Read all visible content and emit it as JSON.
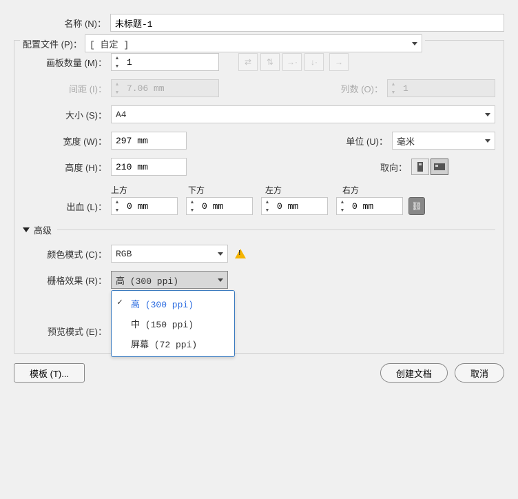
{
  "name": {
    "label": "名称 (N)：",
    "value": "未标题-1"
  },
  "profile": {
    "label": "配置文件 (P)：",
    "value": "[ 自定 ]"
  },
  "artboards": {
    "count_label": "画板数量 (M)：",
    "count_value": "1",
    "spacing_label": "间距 (I)：",
    "spacing_value": "7.06 mm",
    "cols_label": "列数 (O)：",
    "cols_value": "1"
  },
  "size": {
    "label": "大小 (S)：",
    "value": "A4"
  },
  "width": {
    "label": "宽度 (W)：",
    "value": "297 mm"
  },
  "height": {
    "label": "高度 (H)：",
    "value": "210 mm"
  },
  "units": {
    "label": "单位 (U)：",
    "value": "毫米"
  },
  "orient": {
    "label": "取向："
  },
  "bleed": {
    "label": "出血 (L)：",
    "top_h": "上方",
    "bottom_h": "下方",
    "left_h": "左方",
    "right_h": "右方",
    "top": "0 mm",
    "bottom": "0 mm",
    "left": "0 mm",
    "right": "0 mm"
  },
  "advanced_label": "高级",
  "color_mode": {
    "label": "颜色模式 (C)：",
    "value": "RGB"
  },
  "raster": {
    "label": "栅格效果 (R)：",
    "value": "高 (300 ppi)",
    "options": [
      "高 (300 ppi)",
      "中 (150 ppi)",
      "屏幕 (72 ppi)"
    ],
    "selected_index": 0
  },
  "preview": {
    "label": "预览模式 (E)："
  },
  "buttons": {
    "template": "模板 (T)...",
    "create": "创建文档",
    "cancel": "取消"
  }
}
